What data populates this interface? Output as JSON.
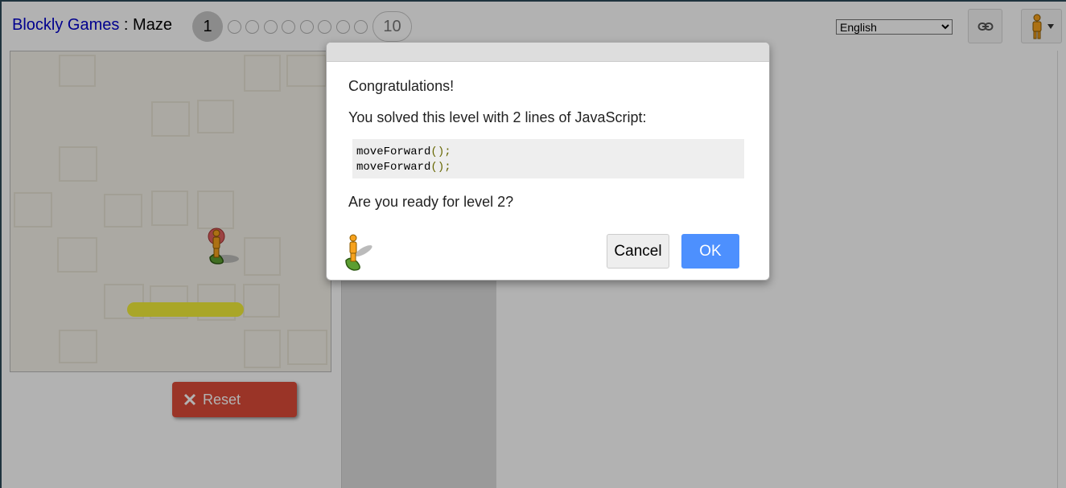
{
  "header": {
    "app_title": "Blockly Games",
    "separator": " : ",
    "game_title": "Maze",
    "levels": {
      "current": "1",
      "last": "10"
    },
    "language": {
      "selected": "English",
      "options": [
        "English"
      ]
    }
  },
  "maze": {
    "reset_label": "Reset"
  },
  "dialog": {
    "congrats": "Congratulations!",
    "solved": "You solved this level with 2 lines of JavaScript:",
    "code_lines": [
      {
        "fn": "moveForward",
        "parens": "();"
      },
      {
        "fn": "moveForward",
        "parens": "();"
      }
    ],
    "question": "Are you ready for level 2?",
    "cancel_label": "Cancel",
    "ok_label": "OK"
  },
  "colors": {
    "link": "#0000cc",
    "reset": "#dd4b39",
    "ok": "#4d90fe",
    "path": "#f2ee3a"
  },
  "icons": [
    "link-icon",
    "pegman-icon",
    "dropdown-arrow-icon",
    "close-x-icon"
  ]
}
